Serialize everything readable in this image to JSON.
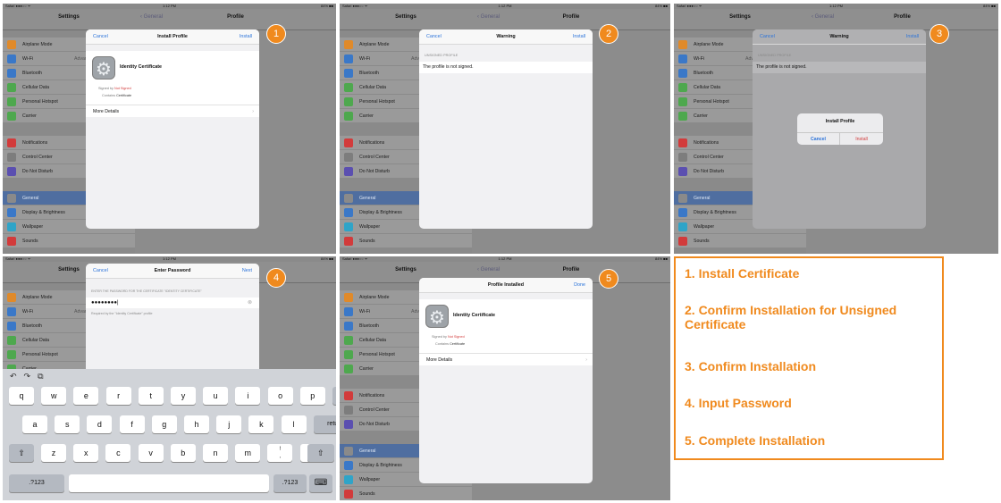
{
  "status": {
    "carrier": "Safari ●●●○○ ᯤ",
    "time": "1:12 PM",
    "battery": "84% ■■"
  },
  "nav": {
    "settings_title": "Settings",
    "back_label": "General",
    "detail_title": "Profile"
  },
  "sidebar": {
    "items": [
      {
        "label": "Airplane Mode",
        "color": "#e08a2a"
      },
      {
        "label": "Wi-Fi",
        "value": "Advance P",
        "color": "#3a78c8"
      },
      {
        "label": "Bluetooth",
        "color": "#3a78c8"
      },
      {
        "label": "Cellular Data",
        "color": "#4ea84e"
      },
      {
        "label": "Personal Hotspot",
        "color": "#4ea84e"
      },
      {
        "label": "Carrier",
        "color": "#4ea84e"
      },
      {
        "label": "Notifications",
        "color": "#d23b3b"
      },
      {
        "label": "Control Center",
        "color": "#7d7d7d"
      },
      {
        "label": "Do Not Disturb",
        "color": "#5b4fb0"
      },
      {
        "label": "General",
        "color": "#8a8a8a"
      },
      {
        "label": "Display & Brightness",
        "color": "#3a78c8"
      },
      {
        "label": "Wallpaper",
        "color": "#2fa4c8"
      },
      {
        "label": "Sounds",
        "color": "#d23b3b"
      }
    ]
  },
  "install": {
    "cancel": "Cancel",
    "title": "Install Profile",
    "action": "Install",
    "cert_name": "Identity Certificate",
    "signed_by_label": "Signed by",
    "signed_by_value": "Not Signed",
    "contains_label": "Contains",
    "contains_value": "Certificate",
    "more_details": "More Details"
  },
  "warning": {
    "cancel": "Cancel",
    "title": "Warning",
    "action": "Install",
    "section": "UNSIGNED PROFILE",
    "message": "The profile is not signed."
  },
  "confirm": {
    "title": "Install Profile",
    "cancel": "Cancel",
    "install": "Install"
  },
  "password": {
    "cancel": "Cancel",
    "title": "Enter Password",
    "next": "Next",
    "prompt": "ENTER THE PASSWORD FOR THE CERTIFICATE \"IDENTITY CERTIFICATE\"",
    "value": "●●●●●●●●|",
    "note": "Required by the \"Identity Certificate\" profile"
  },
  "installed": {
    "title": "Profile Installed",
    "done": "Done",
    "cert_name": "Identity Certificate",
    "signed_by_label": "Signed by",
    "signed_by_value": "Not Signed",
    "contains_label": "Contains",
    "contains_value": "Certificate",
    "more_details": "More Details"
  },
  "keyboard": {
    "toolbar": [
      "↶",
      "↷",
      "⧉"
    ],
    "row1": [
      "q",
      "w",
      "e",
      "r",
      "t",
      "y",
      "u",
      "i",
      "o",
      "p"
    ],
    "row2": [
      "a",
      "s",
      "d",
      "f",
      "g",
      "h",
      "j",
      "k",
      "l"
    ],
    "row3": [
      "z",
      "x",
      "c",
      "v",
      "b",
      "n",
      "m",
      "!\n,",
      "?\n."
    ],
    "delete": "⌫",
    "return": "return",
    "shift": "⇧",
    "numbers": ".?123",
    "hide": "⌨"
  },
  "badges": [
    "1",
    "2",
    "3",
    "4",
    "5"
  ],
  "steps": [
    "1. Install Certificate",
    "2. Confirm Installation for Unsigned Certificate",
    "3. Confirm Installation",
    "4. Input Password",
    "5. Complete Installation"
  ]
}
